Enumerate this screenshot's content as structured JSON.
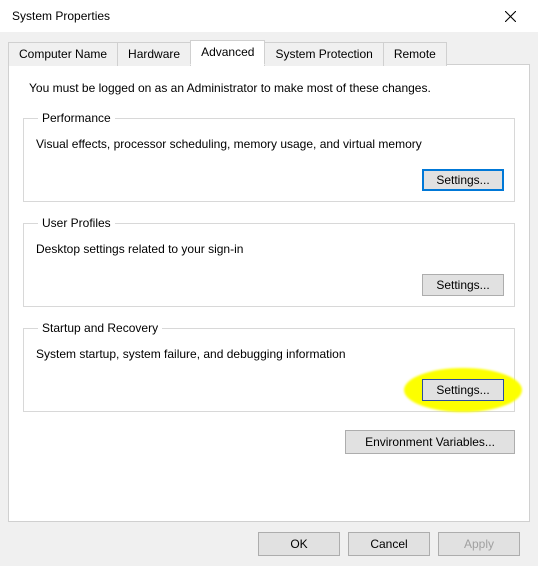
{
  "window": {
    "title": "System Properties"
  },
  "tabs": {
    "computer_name": "Computer Name",
    "hardware": "Hardware",
    "advanced": "Advanced",
    "system_protection": "System Protection",
    "remote": "Remote"
  },
  "intro": "You must be logged on as an Administrator to make most of these changes.",
  "groups": {
    "performance": {
      "legend": "Performance",
      "desc": "Visual effects, processor scheduling, memory usage, and virtual memory",
      "button": "Settings..."
    },
    "user_profiles": {
      "legend": "User Profiles",
      "desc": "Desktop settings related to your sign-in",
      "button": "Settings..."
    },
    "startup": {
      "legend": "Startup and Recovery",
      "desc": "System startup, system failure, and debugging information",
      "button": "Settings..."
    }
  },
  "env_button": "Environment Variables...",
  "footer": {
    "ok": "OK",
    "cancel": "Cancel",
    "apply": "Apply"
  }
}
